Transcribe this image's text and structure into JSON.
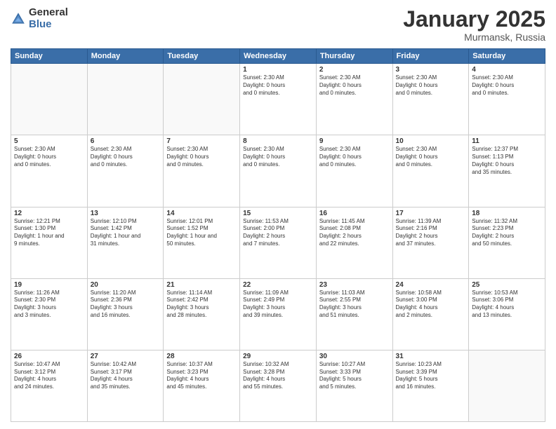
{
  "logo": {
    "general": "General",
    "blue": "Blue"
  },
  "title": "January 2025",
  "location": "Murmansk, Russia",
  "days": [
    "Sunday",
    "Monday",
    "Tuesday",
    "Wednesday",
    "Thursday",
    "Friday",
    "Saturday"
  ],
  "weeks": [
    [
      {
        "num": "",
        "text": "",
        "empty": true
      },
      {
        "num": "",
        "text": "",
        "empty": true
      },
      {
        "num": "",
        "text": "",
        "empty": true
      },
      {
        "num": "1",
        "text": "Sunset: 2:30 AM\nDaylight: 0 hours\nand 0 minutes.",
        "empty": false
      },
      {
        "num": "2",
        "text": "Sunset: 2:30 AM\nDaylight: 0 hours\nand 0 minutes.",
        "empty": false
      },
      {
        "num": "3",
        "text": "Sunset: 2:30 AM\nDaylight: 0 hours\nand 0 minutes.",
        "empty": false
      },
      {
        "num": "4",
        "text": "Sunset: 2:30 AM\nDaylight: 0 hours\nand 0 minutes.",
        "empty": false
      }
    ],
    [
      {
        "num": "5",
        "text": "Sunset: 2:30 AM\nDaylight: 0 hours\nand 0 minutes.",
        "empty": false
      },
      {
        "num": "6",
        "text": "Sunset: 2:30 AM\nDaylight: 0 hours\nand 0 minutes.",
        "empty": false
      },
      {
        "num": "7",
        "text": "Sunset: 2:30 AM\nDaylight: 0 hours\nand 0 minutes.",
        "empty": false
      },
      {
        "num": "8",
        "text": "Sunset: 2:30 AM\nDaylight: 0 hours\nand 0 minutes.",
        "empty": false
      },
      {
        "num": "9",
        "text": "Sunset: 2:30 AM\nDaylight: 0 hours\nand 0 minutes.",
        "empty": false
      },
      {
        "num": "10",
        "text": "Sunset: 2:30 AM\nDaylight: 0 hours\nand 0 minutes.",
        "empty": false
      },
      {
        "num": "11",
        "text": "Sunrise: 12:37 PM\nSunset: 1:13 PM\nDaylight: 0 hours\nand 35 minutes.",
        "empty": false
      }
    ],
    [
      {
        "num": "12",
        "text": "Sunrise: 12:21 PM\nSunset: 1:30 PM\nDaylight: 1 hour and\n9 minutes.",
        "empty": false
      },
      {
        "num": "13",
        "text": "Sunrise: 12:10 PM\nSunset: 1:42 PM\nDaylight: 1 hour and\n31 minutes.",
        "empty": false
      },
      {
        "num": "14",
        "text": "Sunrise: 12:01 PM\nSunset: 1:52 PM\nDaylight: 1 hour and\n50 minutes.",
        "empty": false
      },
      {
        "num": "15",
        "text": "Sunrise: 11:53 AM\nSunset: 2:00 PM\nDaylight: 2 hours\nand 7 minutes.",
        "empty": false
      },
      {
        "num": "16",
        "text": "Sunrise: 11:45 AM\nSunset: 2:08 PM\nDaylight: 2 hours\nand 22 minutes.",
        "empty": false
      },
      {
        "num": "17",
        "text": "Sunrise: 11:39 AM\nSunset: 2:16 PM\nDaylight: 2 hours\nand 37 minutes.",
        "empty": false
      },
      {
        "num": "18",
        "text": "Sunrise: 11:32 AM\nSunset: 2:23 PM\nDaylight: 2 hours\nand 50 minutes.",
        "empty": false
      }
    ],
    [
      {
        "num": "19",
        "text": "Sunrise: 11:26 AM\nSunset: 2:30 PM\nDaylight: 3 hours\nand 3 minutes.",
        "empty": false
      },
      {
        "num": "20",
        "text": "Sunrise: 11:20 AM\nSunset: 2:36 PM\nDaylight: 3 hours\nand 16 minutes.",
        "empty": false
      },
      {
        "num": "21",
        "text": "Sunrise: 11:14 AM\nSunset: 2:42 PM\nDaylight: 3 hours\nand 28 minutes.",
        "empty": false
      },
      {
        "num": "22",
        "text": "Sunrise: 11:09 AM\nSunset: 2:49 PM\nDaylight: 3 hours\nand 39 minutes.",
        "empty": false
      },
      {
        "num": "23",
        "text": "Sunrise: 11:03 AM\nSunset: 2:55 PM\nDaylight: 3 hours\nand 51 minutes.",
        "empty": false
      },
      {
        "num": "24",
        "text": "Sunrise: 10:58 AM\nSunset: 3:00 PM\nDaylight: 4 hours\nand 2 minutes.",
        "empty": false
      },
      {
        "num": "25",
        "text": "Sunrise: 10:53 AM\nSunset: 3:06 PM\nDaylight: 4 hours\nand 13 minutes.",
        "empty": false
      }
    ],
    [
      {
        "num": "26",
        "text": "Sunrise: 10:47 AM\nSunset: 3:12 PM\nDaylight: 4 hours\nand 24 minutes.",
        "empty": false
      },
      {
        "num": "27",
        "text": "Sunrise: 10:42 AM\nSunset: 3:17 PM\nDaylight: 4 hours\nand 35 minutes.",
        "empty": false
      },
      {
        "num": "28",
        "text": "Sunrise: 10:37 AM\nSunset: 3:23 PM\nDaylight: 4 hours\nand 45 minutes.",
        "empty": false
      },
      {
        "num": "29",
        "text": "Sunrise: 10:32 AM\nSunset: 3:28 PM\nDaylight: 4 hours\nand 55 minutes.",
        "empty": false
      },
      {
        "num": "30",
        "text": "Sunrise: 10:27 AM\nSunset: 3:33 PM\nDaylight: 5 hours\nand 5 minutes.",
        "empty": false
      },
      {
        "num": "31",
        "text": "Sunrise: 10:23 AM\nSunset: 3:39 PM\nDaylight: 5 hours\nand 16 minutes.",
        "empty": false
      },
      {
        "num": "",
        "text": "",
        "empty": true
      }
    ]
  ]
}
